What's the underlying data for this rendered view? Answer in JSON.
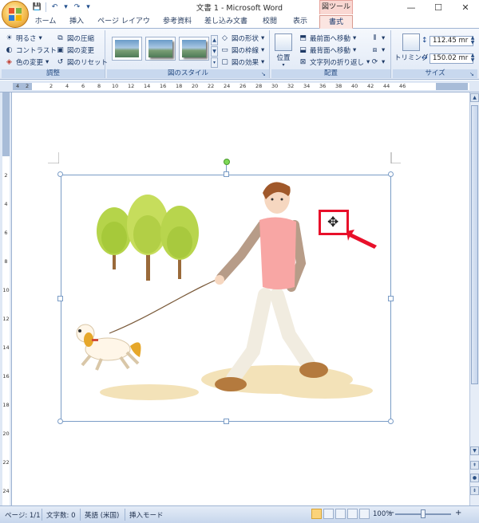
{
  "window": {
    "title": "文書 1 - Microsoft Word",
    "tool_tab_header": "図ツール",
    "controls": {
      "minimize": "—",
      "maximize": "☐",
      "close": "✕"
    }
  },
  "quick_access": {
    "save": "💾",
    "undo": "↶",
    "undo_dd": "▾",
    "redo": "↷",
    "more": "▾"
  },
  "tabs": [
    {
      "label": "ホーム"
    },
    {
      "label": "挿入"
    },
    {
      "label": "ページ レイアウト"
    },
    {
      "label": "参考資料"
    },
    {
      "label": "差し込み文書"
    },
    {
      "label": "校閲"
    },
    {
      "label": "表示"
    },
    {
      "label": "書式"
    }
  ],
  "ribbon": {
    "adjust": {
      "label": "調整",
      "items": [
        "明るさ",
        "コントラスト",
        "色の変更",
        "図の圧縮",
        "図の変更",
        "図のリセット"
      ]
    },
    "picture_styles": {
      "label": "図のスタイル",
      "items": [
        "図の形状",
        "図の枠線",
        "図の効果"
      ]
    },
    "arrange": {
      "label": "配置",
      "position": "位置",
      "items": [
        "最前面へ移動",
        "最背面へ移動",
        "文字列の折り返し"
      ]
    },
    "size": {
      "label": "サイズ",
      "crop": "トリミング",
      "height": "112.45 mr",
      "width": "150.02 mr"
    }
  },
  "ruler": {
    "h_numbers": [
      "4",
      "2",
      "2",
      "4",
      "6",
      "8",
      "10",
      "12",
      "14",
      "16",
      "18",
      "20",
      "22",
      "24",
      "26",
      "28",
      "30",
      "32",
      "34",
      "36",
      "38",
      "40",
      "42",
      "44",
      "46"
    ],
    "v_numbers": [
      "2",
      "4",
      "6",
      "8",
      "10",
      "12",
      "14",
      "16",
      "18",
      "20",
      "22",
      "24"
    ]
  },
  "status_bar": {
    "page": "ページ: 1/1",
    "words": "文字数: 0",
    "language": "英語 (米国)",
    "mode": "挿入モード",
    "zoom": "100%",
    "zoom_out": "−",
    "zoom_in": "+"
  },
  "icons": {
    "move_cursor": "✥",
    "annotation_arrow": "red-arrow"
  },
  "colors": {
    "highlight_box": "#e8102a",
    "tool_tab": "#f9d7d2",
    "ribbon_text": "#1e3a66"
  }
}
